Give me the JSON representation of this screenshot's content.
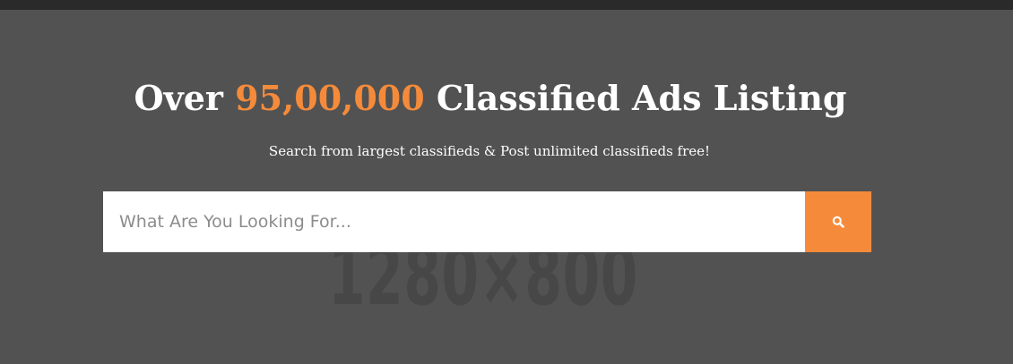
{
  "hero": {
    "title_prefix": "Over",
    "title_count": "95,00,000",
    "title_suffix": "Classified Ads Listing",
    "subtitle": "Search from largest classifieds & Post unlimited classifieds free!",
    "background_watermark": "1280×800"
  },
  "search": {
    "placeholder": "What Are You Looking For...",
    "value": "",
    "button_icon": "search-icon"
  },
  "colors": {
    "accent": "#f58b3a",
    "hero_background": "#525252",
    "top_bar": "#2a2a2a",
    "text": "#ffffff"
  }
}
